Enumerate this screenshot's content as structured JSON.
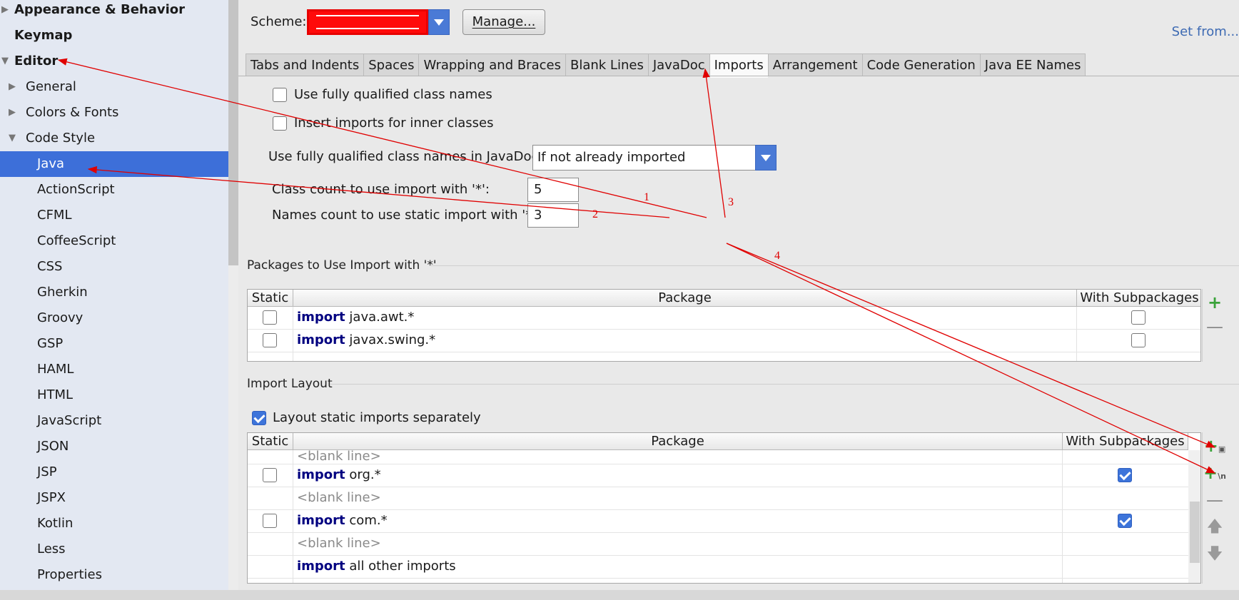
{
  "sidebar": {
    "items": [
      {
        "label": "Appearance & Behavior"
      },
      {
        "label": "Keymap"
      },
      {
        "label": "Editor"
      },
      {
        "label": "General"
      },
      {
        "label": "Colors & Fonts"
      },
      {
        "label": "Code Style"
      },
      {
        "label": "Java"
      },
      {
        "label": "ActionScript"
      },
      {
        "label": "CFML"
      },
      {
        "label": "CoffeeScript"
      },
      {
        "label": "CSS"
      },
      {
        "label": "Gherkin"
      },
      {
        "label": "Groovy"
      },
      {
        "label": "GSP"
      },
      {
        "label": "HAML"
      },
      {
        "label": "HTML"
      },
      {
        "label": "JavaScript"
      },
      {
        "label": "JSON"
      },
      {
        "label": "JSP"
      },
      {
        "label": "JSPX"
      },
      {
        "label": "Kotlin"
      },
      {
        "label": "Less"
      },
      {
        "label": "Properties"
      }
    ],
    "selected": "Java"
  },
  "header": {
    "scheme_label": "Scheme:",
    "manage_label": "Manage...",
    "set_from_label": "Set from..."
  },
  "tabs": [
    {
      "label": "Tabs and Indents"
    },
    {
      "label": "Spaces"
    },
    {
      "label": "Wrapping and Braces"
    },
    {
      "label": "Blank Lines"
    },
    {
      "label": "JavaDoc"
    },
    {
      "label": "Imports",
      "active": true
    },
    {
      "label": "Arrangement"
    },
    {
      "label": "Code Generation"
    },
    {
      "label": "Java EE Names"
    }
  ],
  "imports": {
    "use_fqcn_label": "Use fully qualified class names",
    "use_fqcn_checked": false,
    "inner_classes_label": "Insert imports for inner classes",
    "inner_classes_checked": false,
    "javadoc_label": "Use fully qualified class names in JavaDoc:",
    "javadoc_value": "If not already imported",
    "class_count_label": "Class count to use import with '*':",
    "class_count_value": "5",
    "names_count_label": "Names count to use static import with '*':",
    "names_count_value": "3"
  },
  "packages": {
    "title": "Packages to Use Import with '*'",
    "headers": {
      "static": "Static",
      "package": "Package",
      "subpackages": "With Subpackages"
    },
    "rows": [
      {
        "keyword": "import",
        "name": "java.awt.*",
        "static": false,
        "subpackages": false
      },
      {
        "keyword": "import",
        "name": "javax.swing.*",
        "static": false,
        "subpackages": false
      }
    ]
  },
  "layout": {
    "title": "Import Layout",
    "separate_label": "Layout static imports separately",
    "separate_checked": true,
    "headers": {
      "static": "Static",
      "package": "Package",
      "subpackages": "With Subpackages"
    },
    "rows": [
      {
        "type": "blank",
        "text": "<blank line>"
      },
      {
        "type": "import",
        "keyword": "import",
        "name": "org.*",
        "static": false,
        "subpackages": true
      },
      {
        "type": "blank",
        "text": "<blank line>"
      },
      {
        "type": "import",
        "keyword": "import",
        "name": "com.*",
        "static": false,
        "subpackages": true
      },
      {
        "type": "blank",
        "text": "<blank line>"
      },
      {
        "type": "import",
        "keyword": "import",
        "name": "all other imports",
        "no_static": true
      }
    ]
  },
  "annotations": {
    "labels": [
      "1",
      "2",
      "3",
      "4"
    ],
    "color": "#e00000"
  },
  "colors": {
    "selection": "#3d6fd9",
    "keyword": "#000080",
    "add": "#3aa33a"
  }
}
